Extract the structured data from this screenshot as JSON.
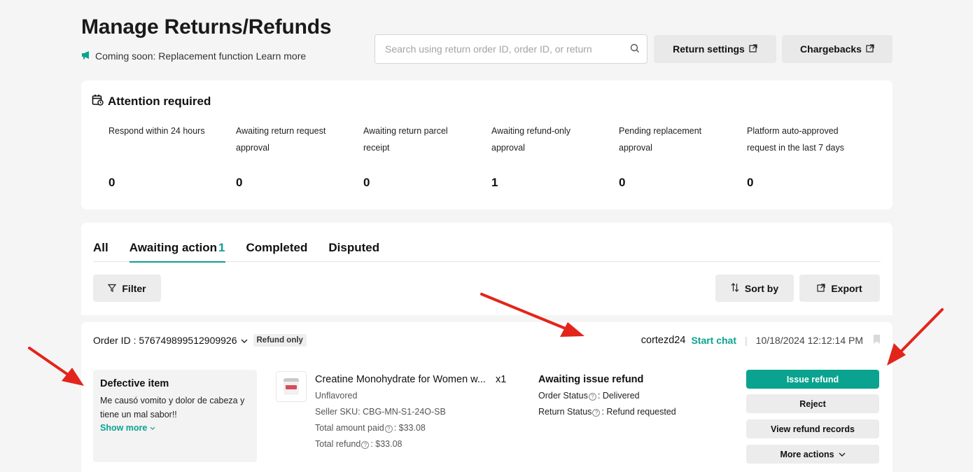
{
  "header": {
    "title": "Manage Returns/Refunds",
    "announcement": "Coming soon: Replacement function Learn more",
    "search_placeholder": "Search using return order ID, order ID, or return",
    "return_settings_label": "Return settings",
    "chargebacks_label": "Chargebacks"
  },
  "attention": {
    "title": "Attention required",
    "metrics": [
      {
        "label": "Respond within 24 hours",
        "value": "0"
      },
      {
        "label": "Awaiting return request approval",
        "value": "0"
      },
      {
        "label": "Awaiting return parcel receipt",
        "value": "0"
      },
      {
        "label": "Awaiting refund-only approval",
        "value": "1"
      },
      {
        "label": "Pending replacement approval",
        "value": "0"
      },
      {
        "label": "Platform auto-approved request in the last 7 days",
        "value": "0"
      }
    ]
  },
  "tabs": [
    {
      "label": "All",
      "count": ""
    },
    {
      "label": "Awaiting action",
      "count": "1"
    },
    {
      "label": "Completed",
      "count": ""
    },
    {
      "label": "Disputed",
      "count": ""
    }
  ],
  "toolbar": {
    "filter_label": "Filter",
    "sort_label": "Sort by",
    "export_label": "Export"
  },
  "order": {
    "id_label": "Order ID : 576749899512909926",
    "type_badge": "Refund only",
    "buyer": "cortezd24",
    "start_chat": "Start chat",
    "timestamp": "10/18/2024 12:12:14 PM",
    "reason_title": "Defective item",
    "reason_text": "Me causó vomito y dolor de cabeza y tiene un mal sabor!!",
    "show_more": "Show more",
    "product_name": "Creatine Monohydrate for Women w...",
    "quantity": "x1",
    "variant": "Unflavored",
    "seller_sku": "Seller SKU: CBG-MN-S1-24O-SB",
    "total_paid_label": "Total amount paid",
    "total_paid_value": ": $33.08",
    "total_refund_label": "Total refund",
    "total_refund_value": ": $33.08",
    "status_title": "Awaiting issue refund",
    "order_status_label": "Order Status",
    "order_status_value": ": Delivered",
    "return_status_label": "Return Status",
    "return_status_value": ": Refund requested",
    "actions": {
      "issue_refund": "Issue refund",
      "reject": "Reject",
      "view_records": "View refund records",
      "more_actions": "More actions"
    }
  },
  "colors": {
    "accent": "#0aa38f",
    "annotation_arrow": "#e3241b"
  },
  "icons": [
    "megaphone-icon",
    "search-icon",
    "external-link-icon",
    "calendar-icon",
    "filter-icon",
    "sort-icon",
    "export-icon",
    "chevron-down-icon",
    "bookmark-icon",
    "help-icon"
  ]
}
